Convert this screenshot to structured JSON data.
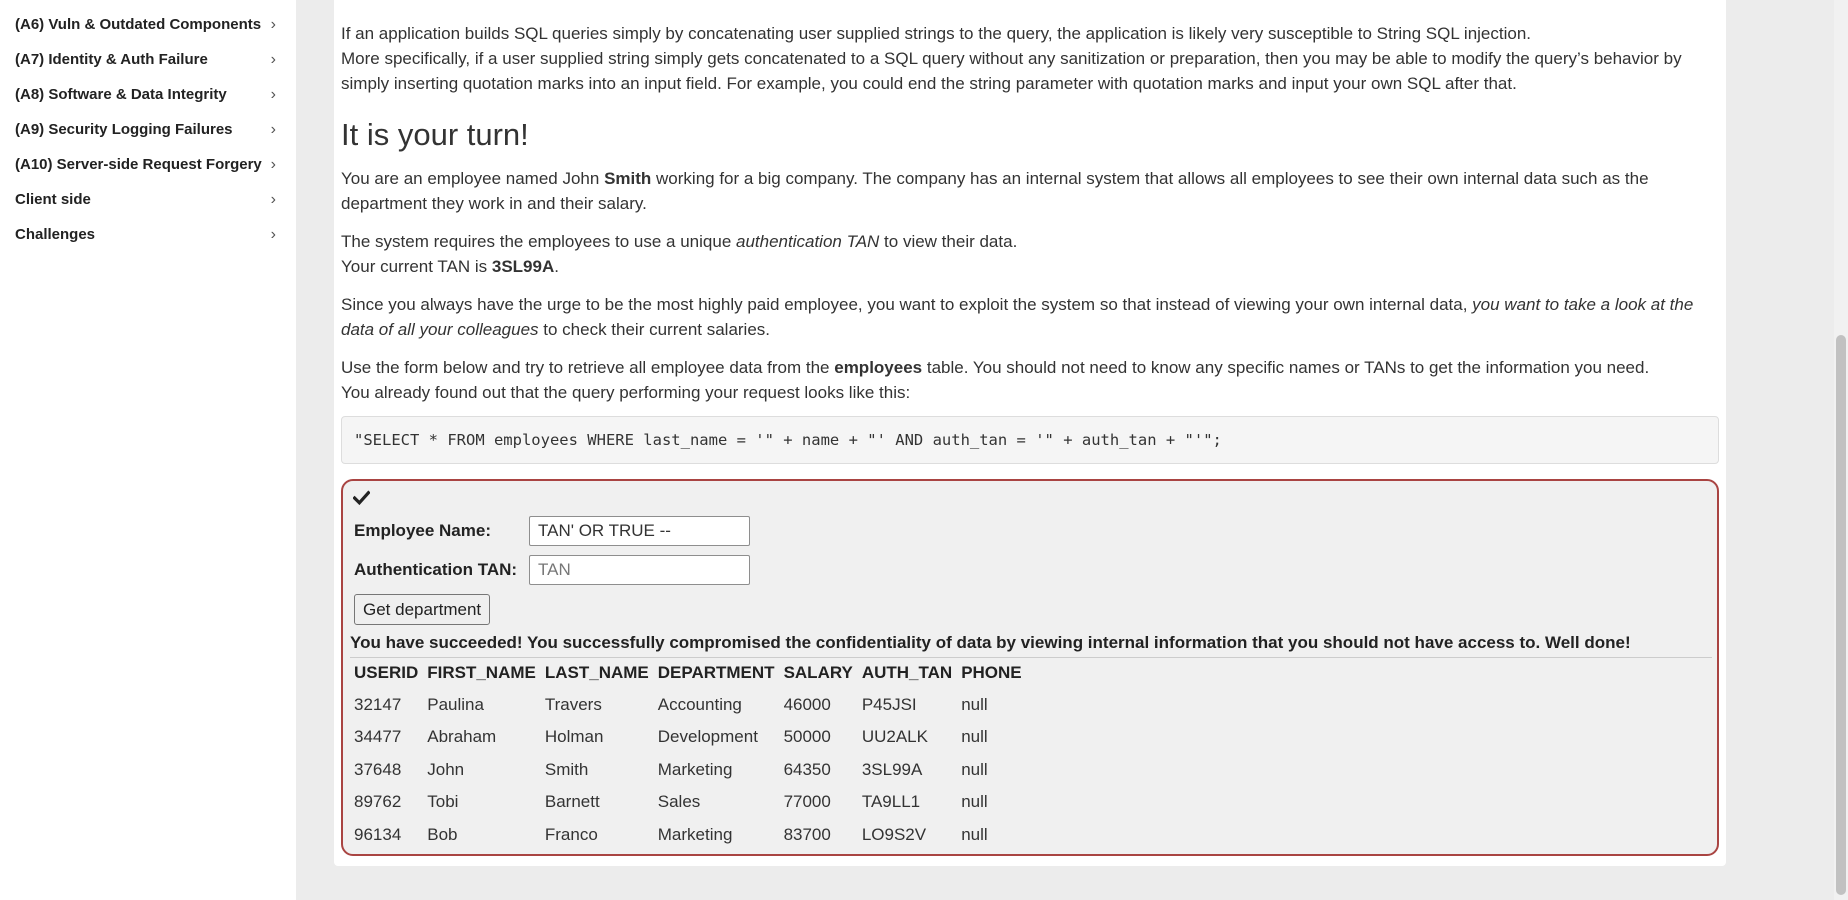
{
  "sidebar": {
    "items": [
      {
        "label": "(A6) Vuln & Outdated Components"
      },
      {
        "label": "(A7) Identity & Auth Failure"
      },
      {
        "label": "(A8) Software & Data Integrity"
      },
      {
        "label": "(A9) Security Logging Failures"
      },
      {
        "label": "(A10) Server-side Request Forgery"
      },
      {
        "label": "Client side"
      },
      {
        "label": "Challenges"
      }
    ],
    "chevron": "›"
  },
  "lesson": {
    "partial_heading": "",
    "intro_line1": "If an application builds SQL queries simply by concatenating user supplied strings to the query, the application is likely very susceptible to String SQL injection.",
    "intro_line2": "More specifically, if a user supplied string simply gets concatenated to a SQL query without any sanitization or preparation, then you may be able to modify the query’s behavior by simply inserting quotation marks into an input field. For example, you could end the string parameter with quotation marks and input your own SQL after that.",
    "turn_heading": "It is your turn!",
    "p2_a": "You are an employee named John ",
    "p2_b": "Smith",
    "p2_c": " working for a big company. The company has an internal system that allows all employees to see their own internal data such as the department they work in and their salary.",
    "p3_a": "The system requires the employees to use a unique ",
    "p3_b": "authentication TAN",
    "p3_c": " to view their data.",
    "p3_d": "Your current TAN is ",
    "p3_e": "3SL99A",
    "p3_f": ".",
    "p4_a": "Since you always have the urge to be the most highly paid employee, you want to exploit the system so that instead of viewing your own internal data, ",
    "p4_b": "you want to take a look at the data of all your colleagues",
    "p4_c": " to check their current salaries.",
    "p5_a": "Use the form below and try to retrieve all employee data from the ",
    "p5_b": "employees",
    "p5_c": " table. You should not need to know any specific names or TANs to get the information you need.",
    "p5_d": "You already found out that the query performing your request looks like this:",
    "query": "\"SELECT * FROM employees WHERE last_name = '\" + name + \"' AND auth_tan = '\" + auth_tan + \"'\";"
  },
  "form": {
    "name_label": "Employee Name:",
    "name_value": "TAN' OR TRUE --",
    "tan_label": "Authentication TAN:",
    "tan_placeholder": "TAN",
    "submit_label": "Get department",
    "feedback": "You have succeeded! You successfully compromised the confidentiality of data by viewing internal information that you should not have access to. Well done!"
  },
  "results": {
    "columns": [
      "USERID",
      "FIRST_NAME",
      "LAST_NAME",
      "DEPARTMENT",
      "SALARY",
      "AUTH_TAN",
      "PHONE"
    ],
    "rows": [
      [
        "32147",
        "Paulina",
        "Travers",
        "Accounting",
        "46000",
        "P45JSI",
        "null"
      ],
      [
        "34477",
        "Abraham",
        "Holman",
        "Development",
        "50000",
        "UU2ALK",
        "null"
      ],
      [
        "37648",
        "John",
        "Smith",
        "Marketing",
        "64350",
        "3SL99A",
        "null"
      ],
      [
        "89762",
        "Tobi",
        "Barnett",
        "Sales",
        "77000",
        "TA9LL1",
        "null"
      ],
      [
        "96134",
        "Bob",
        "Franco",
        "Marketing",
        "83700",
        "LO9S2V",
        "null"
      ]
    ]
  },
  "colors": {
    "attack_border": "#a94442",
    "page_bg": "#ececec"
  }
}
